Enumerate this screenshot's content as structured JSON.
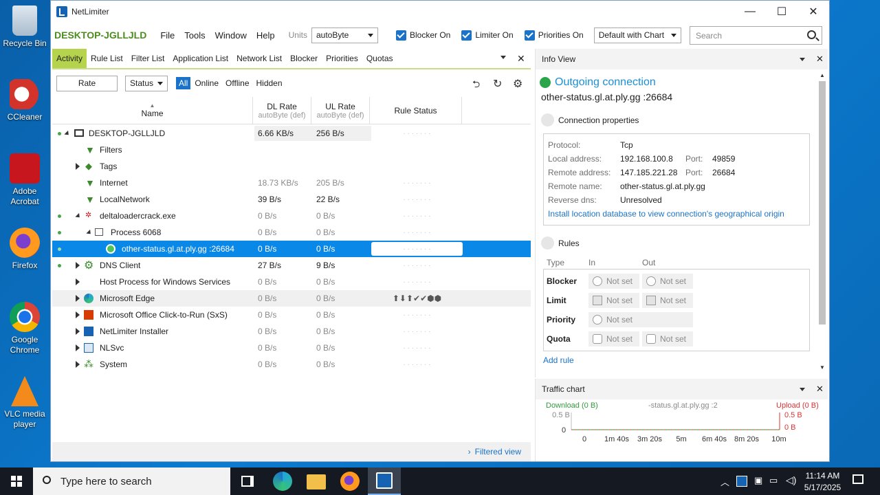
{
  "desktop": {
    "icons": [
      {
        "label": "Recycle Bin"
      },
      {
        "label": "CCleaner"
      },
      {
        "label": "Adobe Acrobat"
      },
      {
        "label": "Firefox"
      },
      {
        "label": "Google Chrome"
      },
      {
        "label": "VLC media player"
      }
    ]
  },
  "window": {
    "title": "NetLimiter",
    "minimize": "—",
    "maximize": "☐",
    "close": "✕"
  },
  "menubar": {
    "host": "DESKTOP-JGLLJLD",
    "menus": [
      "File",
      "Tools",
      "Window",
      "Help"
    ],
    "units_label": "Units",
    "units_value": "autoByte",
    "blocker": "Blocker On",
    "limiter": "Limiter On",
    "priorities": "Priorities On",
    "layout_value": "Default with Chart",
    "search_placeholder": "Search"
  },
  "tabs": [
    "Activity",
    "Rule List",
    "Filter List",
    "Application List",
    "Network List",
    "Blocker",
    "Priorities",
    "Quotas"
  ],
  "toolbar": {
    "rate": "Rate",
    "status": "Status",
    "filters": [
      "All",
      "Online",
      "Offline",
      "Hidden"
    ]
  },
  "columns": {
    "name": "Name",
    "dl": "DL Rate",
    "dl_sub": "autoByte (def)",
    "ul": "UL Rate",
    "ul_sub": "autoByte (def)",
    "rule_status": "Rule Status"
  },
  "rows": [
    {
      "name": "DESKTOP-JGLLJLD",
      "dl": "6.66 KB/s",
      "ul": "256 B/s"
    },
    {
      "name": "Filters",
      "dl": "",
      "ul": ""
    },
    {
      "name": "Tags",
      "dl": "",
      "ul": ""
    },
    {
      "name": "Internet",
      "dl": "18.73 KB/s",
      "ul": "205 B/s"
    },
    {
      "name": "LocalNetwork",
      "dl": "39 B/s",
      "ul": "22 B/s"
    },
    {
      "name": "deltaloadercrack.exe",
      "dl": "0 B/s",
      "ul": "0 B/s"
    },
    {
      "name": "Process 6068",
      "dl": "0 B/s",
      "ul": "0 B/s"
    },
    {
      "name": "other-status.gl.at.ply.gg :26684",
      "dl": "0 B/s",
      "ul": "0 B/s"
    },
    {
      "name": "DNS Client",
      "dl": "27 B/s",
      "ul": "9 B/s"
    },
    {
      "name": "Host Process for Windows Services",
      "dl": "0 B/s",
      "ul": "0 B/s"
    },
    {
      "name": "Microsoft Edge",
      "dl": "0 B/s",
      "ul": "0 B/s"
    },
    {
      "name": "Microsoft Office Click-to-Run (SxS)",
      "dl": "0 B/s",
      "ul": "0 B/s"
    },
    {
      "name": "NetLimiter Installer",
      "dl": "0 B/s",
      "ul": "0 B/s"
    },
    {
      "name": "NLSvc",
      "dl": "0 B/s",
      "ul": "0 B/s"
    },
    {
      "name": "System",
      "dl": "0 B/s",
      "ul": "0 B/s"
    }
  ],
  "filtered_view": "Filtered view",
  "info": {
    "panel_title": "Info View",
    "heading": "Outgoing connection",
    "target": "other-status.gl.at.ply.gg :26684",
    "conn_props": "Connection properties",
    "protocol_k": "Protocol:",
    "protocol_v": "Tcp",
    "local_k": "Local address:",
    "local_v": "192.168.100.8",
    "port_k": "Port:",
    "local_port": "49859",
    "remote_k": "Remote address:",
    "remote_v": "147.185.221.28",
    "remote_port": "26684",
    "rname_k": "Remote name:",
    "rname_v": "other-status.gl.at.ply.gg",
    "rdns_k": "Reverse dns:",
    "rdns_v": "Unresolved",
    "install_link": "Install location database to view connection's geographical origin",
    "rules": "Rules",
    "type_h": "Type",
    "in_h": "In",
    "out_h": "Out",
    "blocker": "Blocker",
    "limit": "Limit",
    "priority": "Priority",
    "quota": "Quota",
    "not_set": "Not set",
    "add_rule": "Add rule"
  },
  "traffic": {
    "title": "Traffic chart",
    "download": "Download (0 B)",
    "upload": "Upload (0 B)",
    "target": "-status.gl.at.ply.gg :2",
    "y_top_left": "0.5 B",
    "y_zero": "0",
    "y_top_right": "0.5 B",
    "y_zero_right": "0 B",
    "ticks": [
      "0",
      "1m 40s",
      "3m 20s",
      "5m",
      "6m 40s",
      "8m 20s",
      "10m"
    ],
    "colors": {
      "download": "#2e9c3a",
      "upload": "#e03030"
    }
  },
  "taskbar": {
    "search_placeholder": "Type here to search",
    "time": "11:14 AM",
    "date": "5/17/2025"
  }
}
